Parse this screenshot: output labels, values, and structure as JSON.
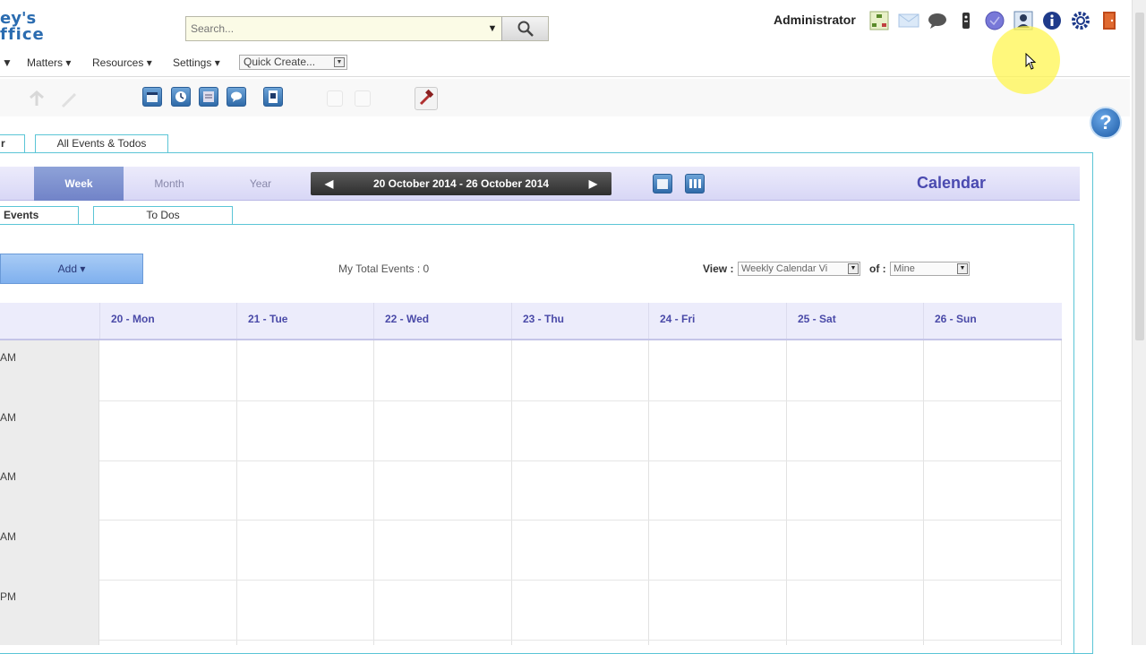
{
  "app": {
    "logo_line1": "ey's",
    "logo_line2": "ffice"
  },
  "search": {
    "placeholder": "Search..."
  },
  "header": {
    "user": "Administrator"
  },
  "menu": {
    "items": [
      "Matters",
      "Resources",
      "Settings"
    ],
    "quick_create": "Quick Create..."
  },
  "tabs": {
    "main_tab_partial": "r",
    "all_events": "All Events & Todos"
  },
  "calendar": {
    "views": [
      "Week",
      "Month",
      "Year"
    ],
    "active_view": "Week",
    "date_range": "20 October 2014 - 26 October 2014",
    "title": "Calendar",
    "subtabs": [
      "Events",
      "To Dos"
    ],
    "add_label": "Add",
    "total_events": "My Total Events : 0",
    "view_label": "View :",
    "view_value": "Weekly Calendar Vi",
    "of_label": "of :",
    "of_value": "Mine",
    "days": [
      "20 - Mon",
      "21 - Tue",
      "22 - Wed",
      "23 - Thu",
      "24 - Fri",
      "25 - Sat",
      "26 - Sun"
    ],
    "time_labels": [
      "AM",
      "AM",
      "AM",
      "AM",
      "PM"
    ]
  },
  "colors": {
    "accent": "#4a4ab0",
    "tab_border": "#5bc5d6",
    "header_bg": "#ececfb"
  },
  "icons": [
    "search-icon",
    "sitemap-icon",
    "mail-icon",
    "chat-icon",
    "remote-icon",
    "globe-icon",
    "user-icon",
    "info-icon",
    "gear-icon",
    "logout-icon",
    "help-icon",
    "calendar-icon",
    "clock-icon"
  ]
}
